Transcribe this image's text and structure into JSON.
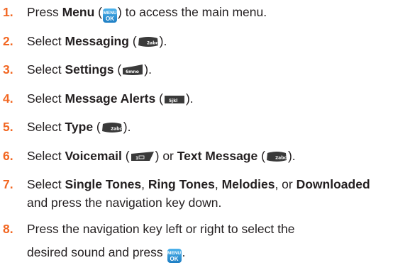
{
  "steps": [
    {
      "number": "1.",
      "parts": [
        "Press ",
        "Menu",
        " (",
        ") to access the main menu."
      ],
      "key": "menu-key"
    },
    {
      "number": "2.",
      "parts": [
        "Select ",
        "Messaging",
        " (",
        ")."
      ],
      "key": "2abc-key",
      "key_label": "2abc"
    },
    {
      "number": "3.",
      "parts": [
        "Select ",
        "Settings",
        " (",
        ")."
      ],
      "key": "6mno-key",
      "key_label": "6mno"
    },
    {
      "number": "4.",
      "parts": [
        "Select ",
        "Message Alerts",
        " (",
        ")."
      ],
      "key": "5jkl-key",
      "key_label": "5jkl"
    },
    {
      "number": "5.",
      "parts": [
        "Select ",
        "Type",
        " (",
        ")."
      ],
      "key": "2abc-key",
      "key_label": "2abc"
    },
    {
      "number": "6.",
      "parts": [
        "Select ",
        "Voicemail",
        " (",
        ") or ",
        "Text Message",
        " (",
        ")."
      ],
      "keys": [
        "1-voicemail-key",
        "2abc-key"
      ],
      "key_label_1": "1",
      "key_label_2": "2abc"
    },
    {
      "number": "7.",
      "parts": [
        "Select ",
        "Single Tones",
        ", ",
        "Ring Tones",
        ", ",
        "Melodies",
        ", or ",
        "Downloaded"
      ],
      "line2": "and press the navigation key down."
    },
    {
      "number": "8.",
      "line1": "Press the navigation key left or right to select the",
      "line2": "desired sound and press ",
      "line2_end": "."
    }
  ],
  "menu_key": {
    "top": "MENU",
    "bottom": "OK"
  },
  "colors": {
    "number": "#f26722",
    "text": "#231f20",
    "key_dark": "#3a3a3a",
    "menu_key": "#2b93d8"
  }
}
